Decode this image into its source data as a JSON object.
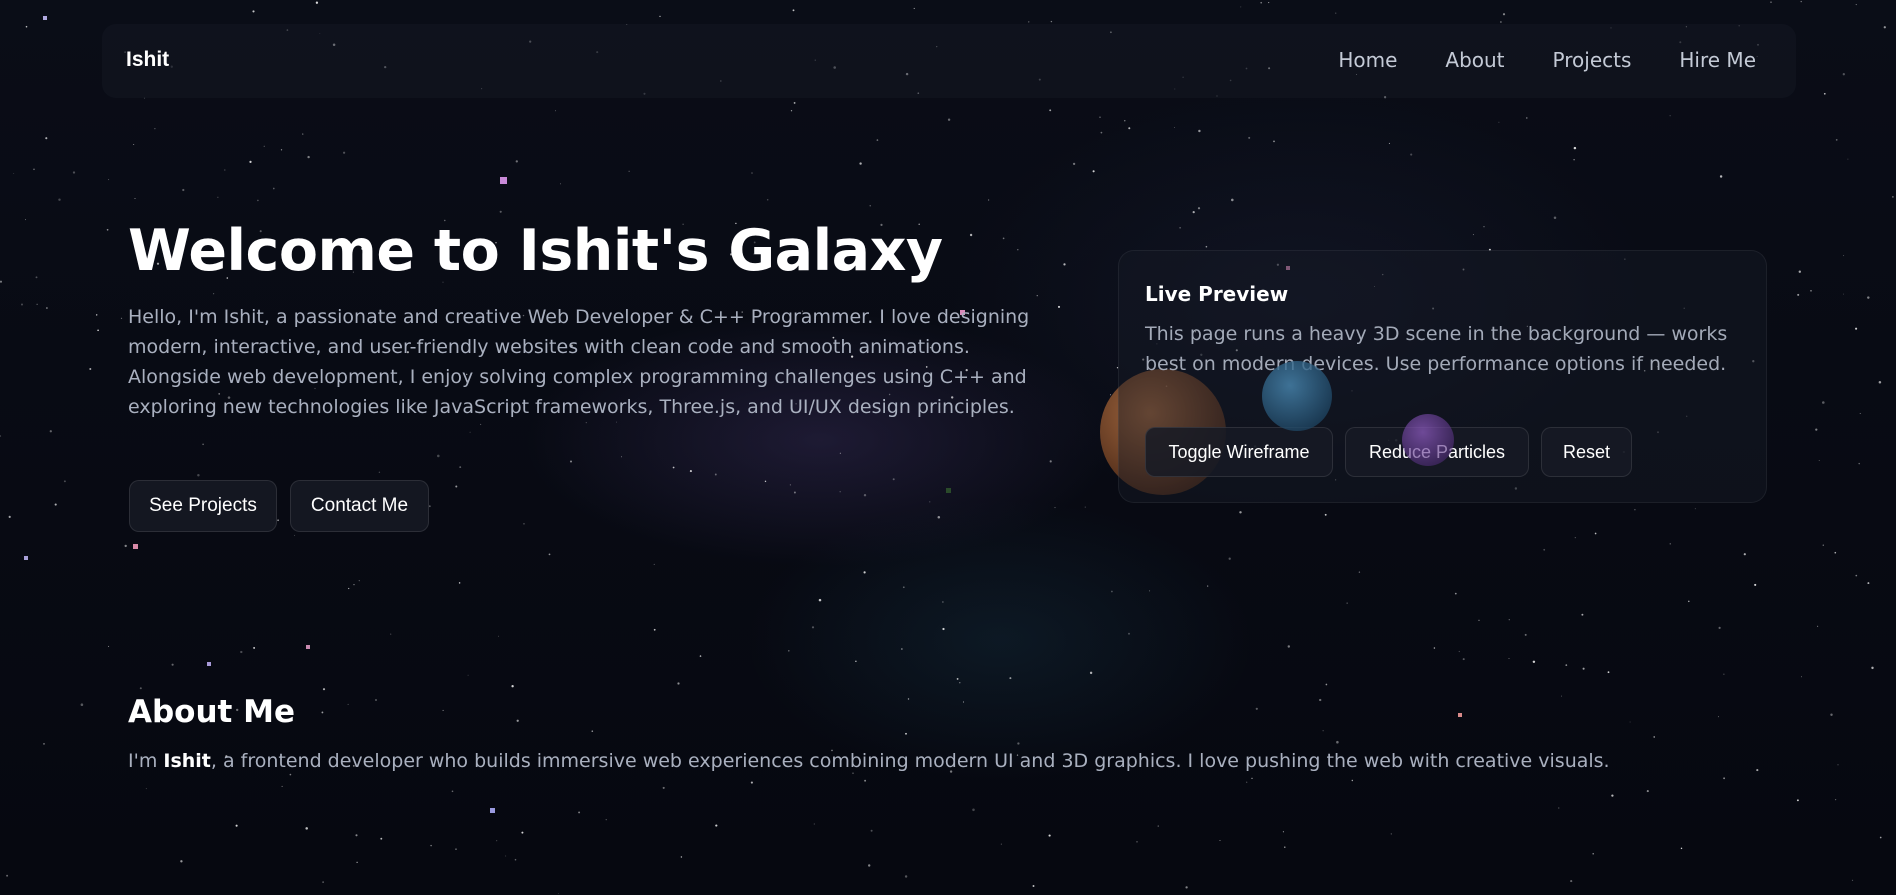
{
  "nav": {
    "brand": "Ishit",
    "links": [
      "Home",
      "About",
      "Projects",
      "Hire Me"
    ]
  },
  "hero": {
    "title": "Welcome to Ishit's Galaxy",
    "text": "Hello, I'm Ishit, a passionate and creative Web Developer & C++ Programmer. I love designing modern, interactive, and user-friendly websites with clean code and smooth animations. Alongside web development, I enjoy solving complex programming challenges using C++ and exploring new technologies like JavaScript frameworks, Three.js, and UI/UX design principles.",
    "buttons": [
      "See Projects",
      "Contact Me"
    ]
  },
  "preview": {
    "title": "Live Preview",
    "text": "This page runs a heavy 3D scene in the background — works best on modern devices. Use performance options if needed.",
    "buttons": [
      "Toggle Wireframe",
      "Reduce Particles",
      "Reset"
    ]
  },
  "about": {
    "title": "About Me",
    "text_prefix": "I'm ",
    "name": "Ishit",
    "text_suffix": ", a frontend developer who builds immersive web experiences combining modern UI and 3D graphics. I love pushing the web with creative visuals."
  }
}
